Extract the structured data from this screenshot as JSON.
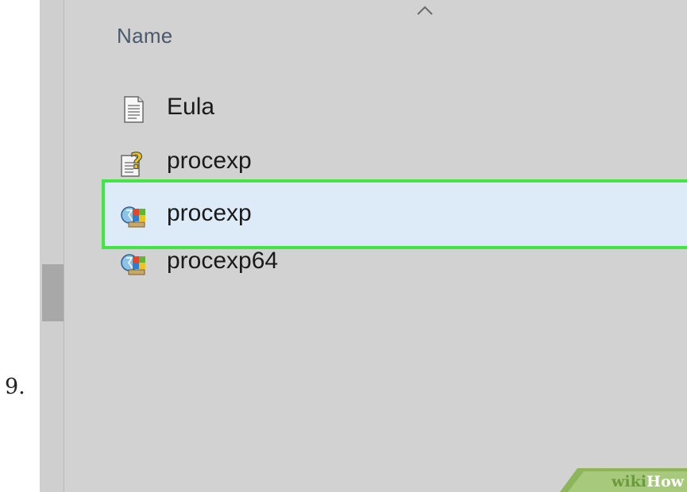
{
  "step_number": "9.",
  "explorer": {
    "column_header": "Name",
    "files": [
      {
        "name": "Eula",
        "icon": "text-document-icon"
      },
      {
        "name": "procexp",
        "icon": "help-file-icon"
      },
      {
        "name": "procexp",
        "icon": "process-explorer-icon",
        "selected": true
      },
      {
        "name": "procexp64",
        "icon": "process-explorer-icon"
      }
    ]
  },
  "watermark": {
    "wiki": "wiki",
    "how": "How"
  },
  "colors": {
    "highlight_border": "#44e444",
    "selection_fill": "#dcebf7",
    "wikihow_green": "#6a9a3c"
  }
}
